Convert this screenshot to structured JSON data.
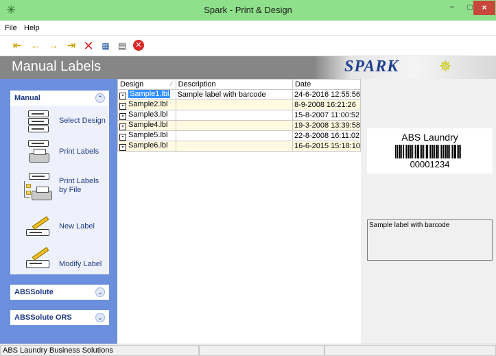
{
  "window": {
    "title": "Spark - Print & Design",
    "min": "−",
    "max": "□",
    "close": "×"
  },
  "menu": [
    "File",
    "Help"
  ],
  "toolbar": {
    "first_icon": "first-record-icon",
    "prev_icon": "previous-record-icon",
    "next_icon": "next-record-icon",
    "last_icon": "last-record-icon",
    "delete_icon": "delete-icon",
    "rename_icon": "rename-icon",
    "copy_icon": "copy-icon",
    "stop_icon": "stop-icon"
  },
  "banner": {
    "title": "Manual Labels",
    "logo": "SPARK"
  },
  "sidebar": {
    "groups": [
      {
        "title": "Manual",
        "expanded": true,
        "items": [
          {
            "label": "Select Design",
            "icon": "select-design-icon"
          },
          {
            "label": "Print Labels",
            "icon": "print-labels-icon"
          },
          {
            "label": "Print Labels by File",
            "icon": "print-labels-by-file-icon"
          },
          {
            "label": "New Label",
            "icon": "new-label-icon"
          },
          {
            "label": "Modify Label",
            "icon": "modify-label-icon"
          }
        ]
      },
      {
        "title": "ABSSolute",
        "expanded": false
      },
      {
        "title": "ABSSolute ORS",
        "expanded": false
      }
    ]
  },
  "table": {
    "headers": [
      "Design",
      "Description",
      "Date"
    ],
    "rows": [
      {
        "design": "Sample1.lbl",
        "description": "Sample label with barcode",
        "date": "24-6-2016 12:55:56"
      },
      {
        "design": "Sample2.lbl",
        "description": "",
        "date": "8-9-2008 16:21:26"
      },
      {
        "design": "Sample3.lbl",
        "description": "",
        "date": "15-8-2007 11:00:52"
      },
      {
        "design": "Sample4.lbl",
        "description": "",
        "date": "19-3-2008 13:39:58"
      },
      {
        "design": "Sample5.lbl",
        "description": "",
        "date": "22-8-2008 16:11:02"
      },
      {
        "design": "Sample6.lbl",
        "description": "",
        "date": "16-6-2015 15:18:10"
      }
    ]
  },
  "preview": {
    "title": "ABS Laundry",
    "code": "00001234",
    "description": "Sample label with barcode"
  },
  "status": {
    "text": "ABS Laundry Business Solutions"
  },
  "colors": {
    "titlebar": "#8fe08a",
    "sidebar": "#6b8fdc",
    "selection": "#3390ff",
    "close": "#c7473b"
  }
}
